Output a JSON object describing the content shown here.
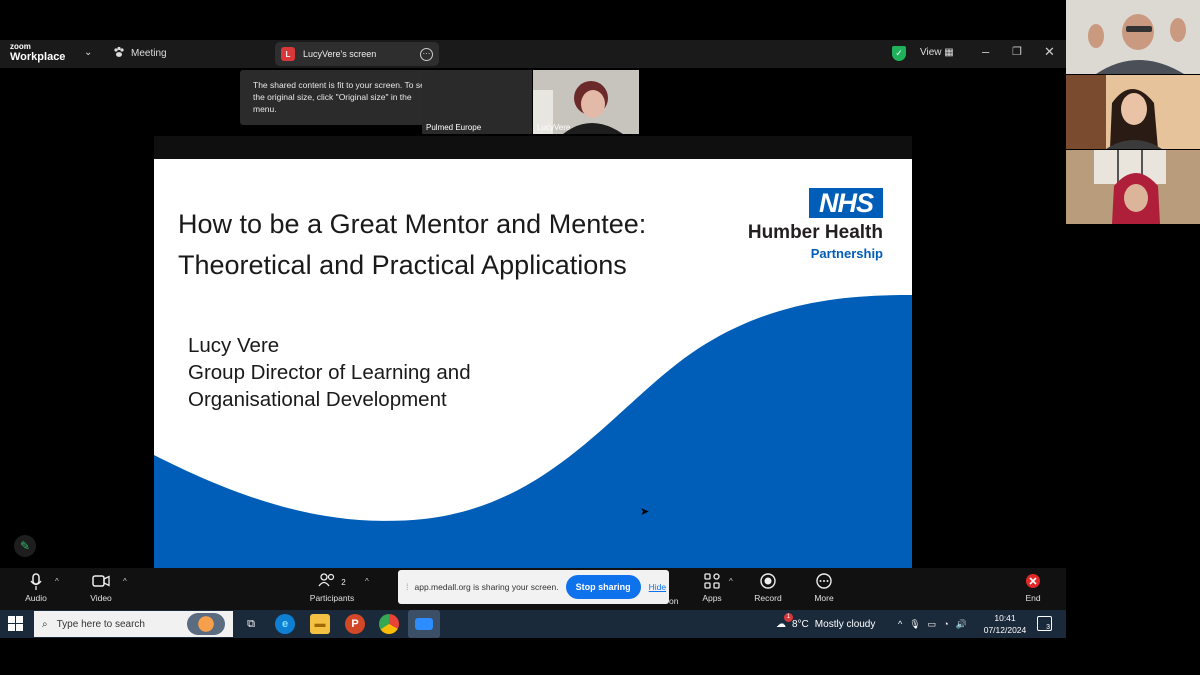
{
  "title_bar": {
    "logo_small": "zoom",
    "logo_large": "Workplace",
    "meeting_label": "Meeting",
    "screen_share_label": "LucyVere's screen",
    "screen_share_avatar_letter": "L",
    "view_label": "View",
    "security_color": "#1fb25a"
  },
  "tooltip": {
    "text": "The shared content is fit to your screen. To see the original size, click \"Original size\" in the menu."
  },
  "mini_tiles": {
    "left_name": "Pulmed Europe",
    "right_name": "LucyVere"
  },
  "slide": {
    "title_line1": "How to be a Great Mentor and Mentee:",
    "title_line2": "Theoretical and Practical Applications",
    "logo_text": "NHS",
    "org_name": "Humber Health",
    "org_sub": "Partnership",
    "presenter_name": "Lucy Vere",
    "presenter_role_line1": "Group Director of Learning and",
    "presenter_role_line2": "Organisational Development",
    "brand_color": "#005eb8"
  },
  "toolbar": {
    "audio_label": "Audio",
    "video_label": "Video",
    "participants_label": "Participants",
    "participants_count": "2",
    "apps_label": "Apps",
    "record_label": "Record",
    "more_label": "More",
    "end_label": "End",
    "partial_label": "on"
  },
  "share_bar": {
    "message": "app.medall.org is sharing your screen.",
    "stop_label": "Stop sharing",
    "hide_label": "Hide"
  },
  "taskbar": {
    "search_placeholder": "Type here to search",
    "weather_temp": "8°C",
    "weather_text": "Mostly cloudy",
    "weather_badge": "1",
    "time": "10:41",
    "date": "07/12/2024",
    "notification_count": "3"
  }
}
